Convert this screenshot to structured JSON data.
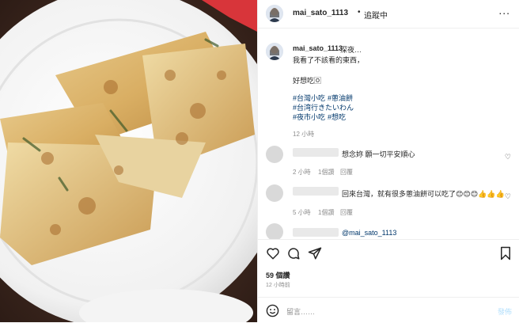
{
  "header": {
    "username": "mai_sato_1113",
    "separator": "•",
    "follow_status": "追蹤中",
    "more": "..."
  },
  "caption": {
    "username": "mai_sato_1113",
    "first_line": "深夜…",
    "line2": "我看了不該看的東西，",
    "line3": "好想吃🄾",
    "hashtags": [
      "#台灣小吃",
      "#蔥油餅",
      "#台湾行きたいわん",
      "#夜市小吃",
      "#想吃"
    ],
    "time": "12 小時"
  },
  "comments": [
    {
      "text": "想念妳 願一切平安順心",
      "time": "2 小時",
      "likes": "1個讚",
      "reply": "回覆"
    },
    {
      "text": "回來台灣，就有很多蔥油餅可以吃了😊😊😊👍👍👍",
      "time": "5 小時",
      "likes": "1個讚",
      "reply": "回覆"
    },
    {
      "mention": "@mai_sato_1113"
    }
  ],
  "actions": {
    "likes": "59 個讚",
    "post_time": "12 小時前"
  },
  "compose": {
    "placeholder": "留言……",
    "post_label": "發佈"
  },
  "colors": {
    "link": "#00376b",
    "muted": "#8e8e8e",
    "post_disabled": "#b2dffc"
  }
}
